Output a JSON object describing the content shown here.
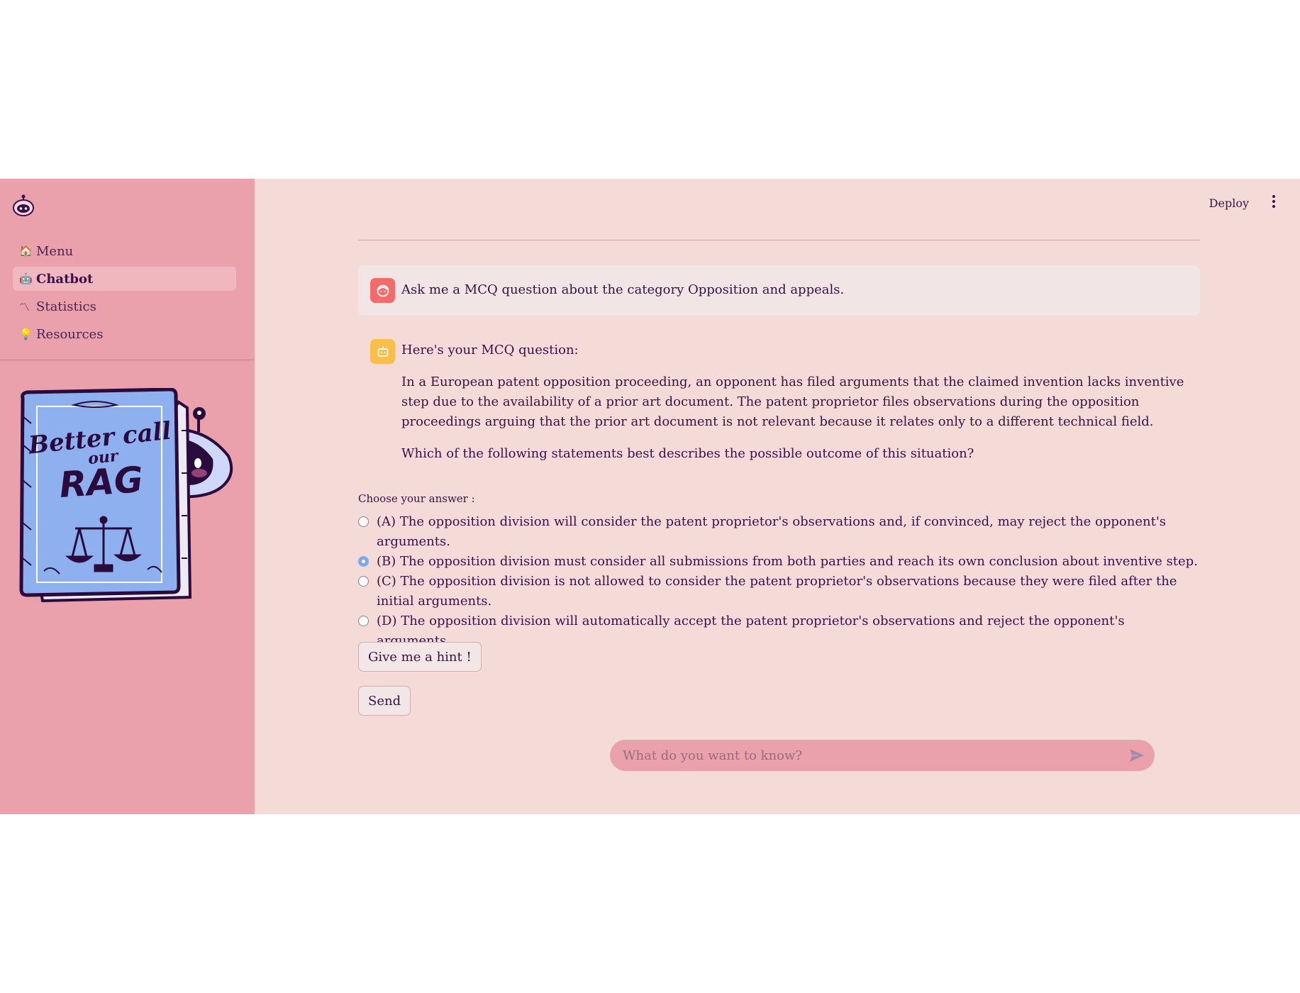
{
  "sidebar": {
    "items": [
      {
        "icon": "🏠",
        "label": "Menu",
        "active": false
      },
      {
        "icon": "🤖",
        "label": "Chatbot",
        "active": true
      },
      {
        "icon": "〽",
        "label": "Statistics",
        "active": false
      },
      {
        "icon": "💡",
        "label": "Resources",
        "active": false
      }
    ],
    "mascot": {
      "line1": "Better call",
      "line2": "our",
      "line3": "RAG"
    }
  },
  "header": {
    "deploy_label": "Deploy",
    "menu_icon": "kebab-menu-icon"
  },
  "chat": {
    "user_message": "Ask me a MCQ question about the category Opposition and appeals.",
    "bot_intro": "Here's your MCQ question:",
    "bot_question": "In a European patent opposition proceeding, an opponent has filed arguments that the claimed invention lacks inventive step due to the availability of a prior art document. The patent proprietor files observations during the opposition proceedings arguing that the prior art document is not relevant because it relates only to a different technical field.",
    "bot_ask": "Which of the following statements best describes the possible outcome of this situation?"
  },
  "quiz": {
    "label": "Choose your answer :",
    "options": [
      "(A) The opposition division will consider the patent proprietor's observations and, if convinced, may reject the opponent's arguments.",
      "(B) The opposition division must consider all submissions from both parties and reach its own conclusion about inventive step.",
      "(C) The opposition division is not allowed to consider the patent proprietor's observations because they were filed after the initial arguments.",
      "(D) The opposition division will automatically accept the patent proprietor's observations and reject the opponent's arguments."
    ],
    "selected_index": 1,
    "hint_label": "Give me a hint !",
    "send_label": "Send"
  },
  "input": {
    "placeholder": "What do you want to know?"
  },
  "colors": {
    "sidebar_bg": "#eba1ab",
    "main_bg": "#f5dbd8",
    "text": "#3a1048",
    "user_avatar": "#f36b6b",
    "bot_avatar": "#fbbe4a",
    "radio_selected": "#7ea7f0",
    "book": "#8fb0ef"
  }
}
